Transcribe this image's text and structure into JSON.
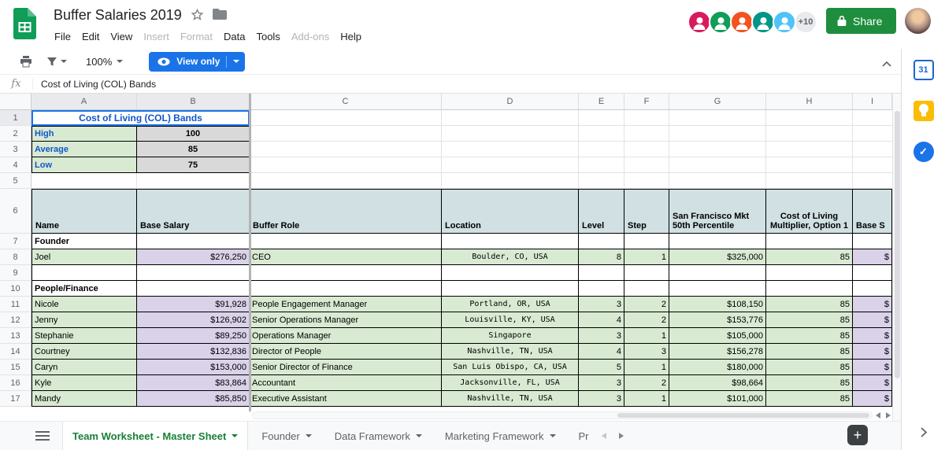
{
  "header": {
    "title": "Buffer Salaries 2019",
    "menus": [
      {
        "label": "File",
        "disabled": false
      },
      {
        "label": "Edit",
        "disabled": false
      },
      {
        "label": "View",
        "disabled": false
      },
      {
        "label": "Insert",
        "disabled": true
      },
      {
        "label": "Format",
        "disabled": true
      },
      {
        "label": "Data",
        "disabled": false
      },
      {
        "label": "Tools",
        "disabled": false
      },
      {
        "label": "Add-ons",
        "disabled": true
      },
      {
        "label": "Help",
        "disabled": false
      }
    ],
    "presence_overflow": "+10",
    "presence_colors": [
      "#d81b60",
      "#0f9d58",
      "#f4511e",
      "#009688",
      "#4fc3f7"
    ],
    "share_label": "Share"
  },
  "toolbar": {
    "zoom": "100%",
    "view_only_label": "View only"
  },
  "formula_bar": {
    "fx_label": "fx",
    "value": "Cost of Living (COL) Bands"
  },
  "grid": {
    "column_letters": [
      "A",
      "B",
      "C",
      "D",
      "E",
      "F",
      "G",
      "H",
      "I"
    ],
    "row_numbers": [
      "1",
      "2",
      "3",
      "4",
      "5",
      "6",
      "7",
      "8",
      "9",
      "10",
      "11",
      "12",
      "13",
      "14",
      "15",
      "16",
      "17"
    ],
    "col_bands": {
      "title": "Cost of Living (COL) Bands",
      "rows": [
        {
          "label": "High",
          "value": "100"
        },
        {
          "label": "Average",
          "value": "85"
        },
        {
          "label": "Low",
          "value": "75"
        }
      ]
    },
    "table": {
      "headers": {
        "name": "Name",
        "base_salary": "Base Salary",
        "role": "Buffer Role",
        "location": "Location",
        "level": "Level",
        "step": "Step",
        "sf_percentile": "San Francisco Mkt 50th Percentile",
        "col_multiplier": "Cost of Living Multiplier, Option 1",
        "base_col": "Base S"
      },
      "sections": {
        "founder": "Founder",
        "people_finance": "People/Finance"
      },
      "rows": [
        {
          "name": "Joel",
          "base_salary": "$276,250",
          "role": "CEO",
          "location": "Boulder, CO, USA",
          "level": "8",
          "step": "1",
          "sf_percentile": "$325,000",
          "col_multiplier": "85",
          "base_col_fragment": "$"
        },
        {
          "name": "Nicole",
          "base_salary": "$91,928",
          "role": "People Engagement Manager",
          "location": "Portland, OR, USA",
          "level": "3",
          "step": "2",
          "sf_percentile": "$108,150",
          "col_multiplier": "85",
          "base_col_fragment": "$"
        },
        {
          "name": "Jenny",
          "base_salary": "$126,902",
          "role": "Senior Operations Manager",
          "location": "Louisville, KY, USA",
          "level": "4",
          "step": "2",
          "sf_percentile": "$153,776",
          "col_multiplier": "85",
          "base_col_fragment": "$"
        },
        {
          "name": "Stephanie",
          "base_salary": "$89,250",
          "role": "Operations Manager",
          "location": "Singapore",
          "level": "3",
          "step": "1",
          "sf_percentile": "$105,000",
          "col_multiplier": "85",
          "base_col_fragment": "$"
        },
        {
          "name": "Courtney",
          "base_salary": "$132,836",
          "role": "Director of People",
          "location": "Nashville, TN, USA",
          "level": "4",
          "step": "3",
          "sf_percentile": "$156,278",
          "col_multiplier": "85",
          "base_col_fragment": "$"
        },
        {
          "name": "Caryn",
          "base_salary": "$153,000",
          "role": "Senior Director of Finance",
          "location": "San Luis Obispo, CA, USA",
          "level": "5",
          "step": "1",
          "sf_percentile": "$180,000",
          "col_multiplier": "85",
          "base_col_fragment": "$"
        },
        {
          "name": "Kyle",
          "base_salary": "$83,864",
          "role": "Accountant",
          "location": "Jacksonville, FL, USA",
          "level": "3",
          "step": "2",
          "sf_percentile": "$98,664",
          "col_multiplier": "85",
          "base_col_fragment": "$"
        },
        {
          "name": "Mandy",
          "base_salary": "$85,850",
          "role": "Executive Assistant",
          "location": "Nashville, TN, USA",
          "level": "3",
          "step": "1",
          "sf_percentile": "$101,000",
          "col_multiplier": "85",
          "base_col_fragment": "$"
        }
      ]
    }
  },
  "sheet_tabs": {
    "active": "Team Worksheet - Master Sheet",
    "others": [
      "Founder",
      "Data Framework",
      "Marketing Framework",
      "Pr"
    ]
  },
  "side_panel": {
    "calendar_label": "31"
  },
  "colors": {
    "share_green": "#1e8e3e",
    "view_only_blue": "#1a73e8",
    "link_blue": "#1155cc",
    "data_row_green": "#d9ead3",
    "salary_purple": "#d9d2e9",
    "table_header_teal": "#d0e0e3",
    "band_value_gray": "#d9d9d9",
    "active_tab_green": "#188038"
  }
}
